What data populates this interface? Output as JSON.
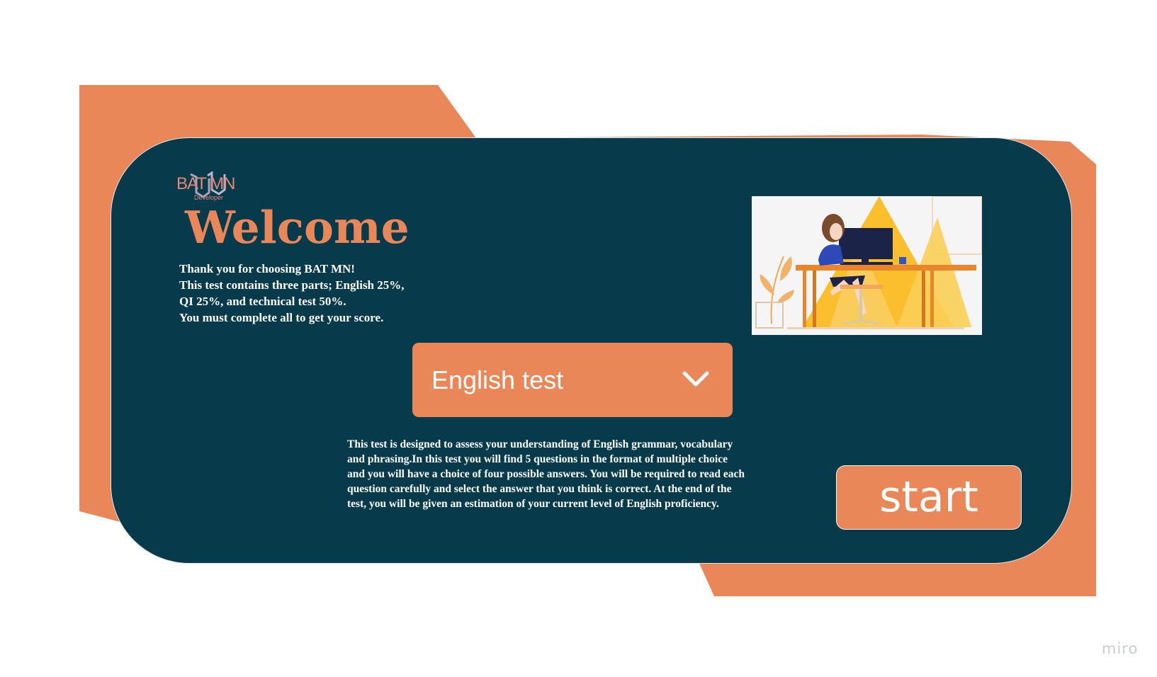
{
  "logo": {
    "brand": "BAT MN",
    "subtitle": "Developer"
  },
  "welcome": {
    "title": "Welcome",
    "intro_lines": [
      "Thank you for choosing BAT MN!",
      "This test contains three parts; English 25%,",
      "QI 25%, and technical test 50%.",
      "You must complete all to get your score."
    ]
  },
  "test_select": {
    "value": "English test",
    "icon": "chevron-down-icon"
  },
  "description_lines": [
    "This test is designed to assess your understanding of English grammar, vocabulary",
    "and phrasing.In this test you will find 5 questions in the format of multiple choice",
    "and you will have a choice of four possible answers. You will be required to read each",
    "question carefully and select the answer that you think is correct. At the end of the",
    "test, you will be given an estimation of your current level of English proficiency."
  ],
  "start_button": {
    "label": "start"
  },
  "watermark": "miro",
  "colors": {
    "accent": "#ea8759",
    "card": "#073a4b",
    "text_on_dark": "#ffffff"
  }
}
